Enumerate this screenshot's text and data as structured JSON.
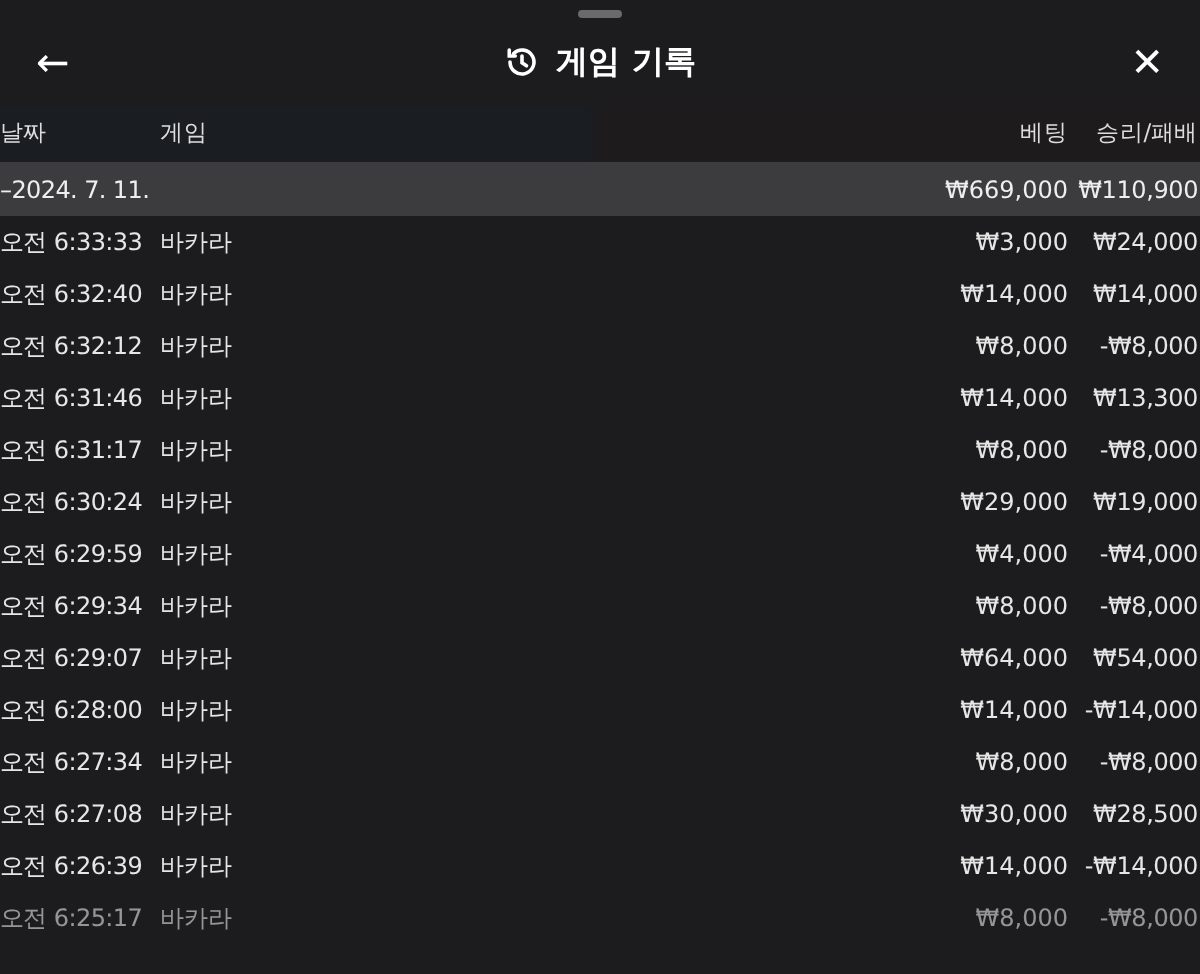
{
  "header": {
    "back": "←",
    "title": "게임 기록",
    "close": "✕"
  },
  "columns": [
    "날짜",
    "게임",
    "베팅",
    "승리/패배"
  ],
  "summary": {
    "date": "–2024. 7. 11.",
    "bet": "₩669,000",
    "result": "₩110,900"
  },
  "rows": [
    {
      "time": "오전 6:33:33",
      "game": "바카라",
      "bet": "₩3,000",
      "result": "₩24,000"
    },
    {
      "time": "오전 6:32:40",
      "game": "바카라",
      "bet": "₩14,000",
      "result": "₩14,000"
    },
    {
      "time": "오전 6:32:12",
      "game": "바카라",
      "bet": "₩8,000",
      "result": "-₩8,000"
    },
    {
      "time": "오전 6:31:46",
      "game": "바카라",
      "bet": "₩14,000",
      "result": "₩13,300"
    },
    {
      "time": "오전 6:31:17",
      "game": "바카라",
      "bet": "₩8,000",
      "result": "-₩8,000"
    },
    {
      "time": "오전 6:30:24",
      "game": "바카라",
      "bet": "₩29,000",
      "result": "₩19,000"
    },
    {
      "time": "오전 6:29:59",
      "game": "바카라",
      "bet": "₩4,000",
      "result": "-₩4,000"
    },
    {
      "time": "오전 6:29:34",
      "game": "바카라",
      "bet": "₩8,000",
      "result": "-₩8,000"
    },
    {
      "time": "오전 6:29:07",
      "game": "바카라",
      "bet": "₩64,000",
      "result": "₩54,000"
    },
    {
      "time": "오전 6:28:00",
      "game": "바카라",
      "bet": "₩14,000",
      "result": "-₩14,000"
    },
    {
      "time": "오전 6:27:34",
      "game": "바카라",
      "bet": "₩8,000",
      "result": "-₩8,000"
    },
    {
      "time": "오전 6:27:08",
      "game": "바카라",
      "bet": "₩30,000",
      "result": "₩28,500"
    },
    {
      "time": "오전 6:26:39",
      "game": "바카라",
      "bet": "₩14,000",
      "result": "-₩14,000"
    },
    {
      "time": "오전 6:25:17",
      "game": "바카라",
      "bet": "₩8,000",
      "result": "-₩8,000"
    }
  ]
}
